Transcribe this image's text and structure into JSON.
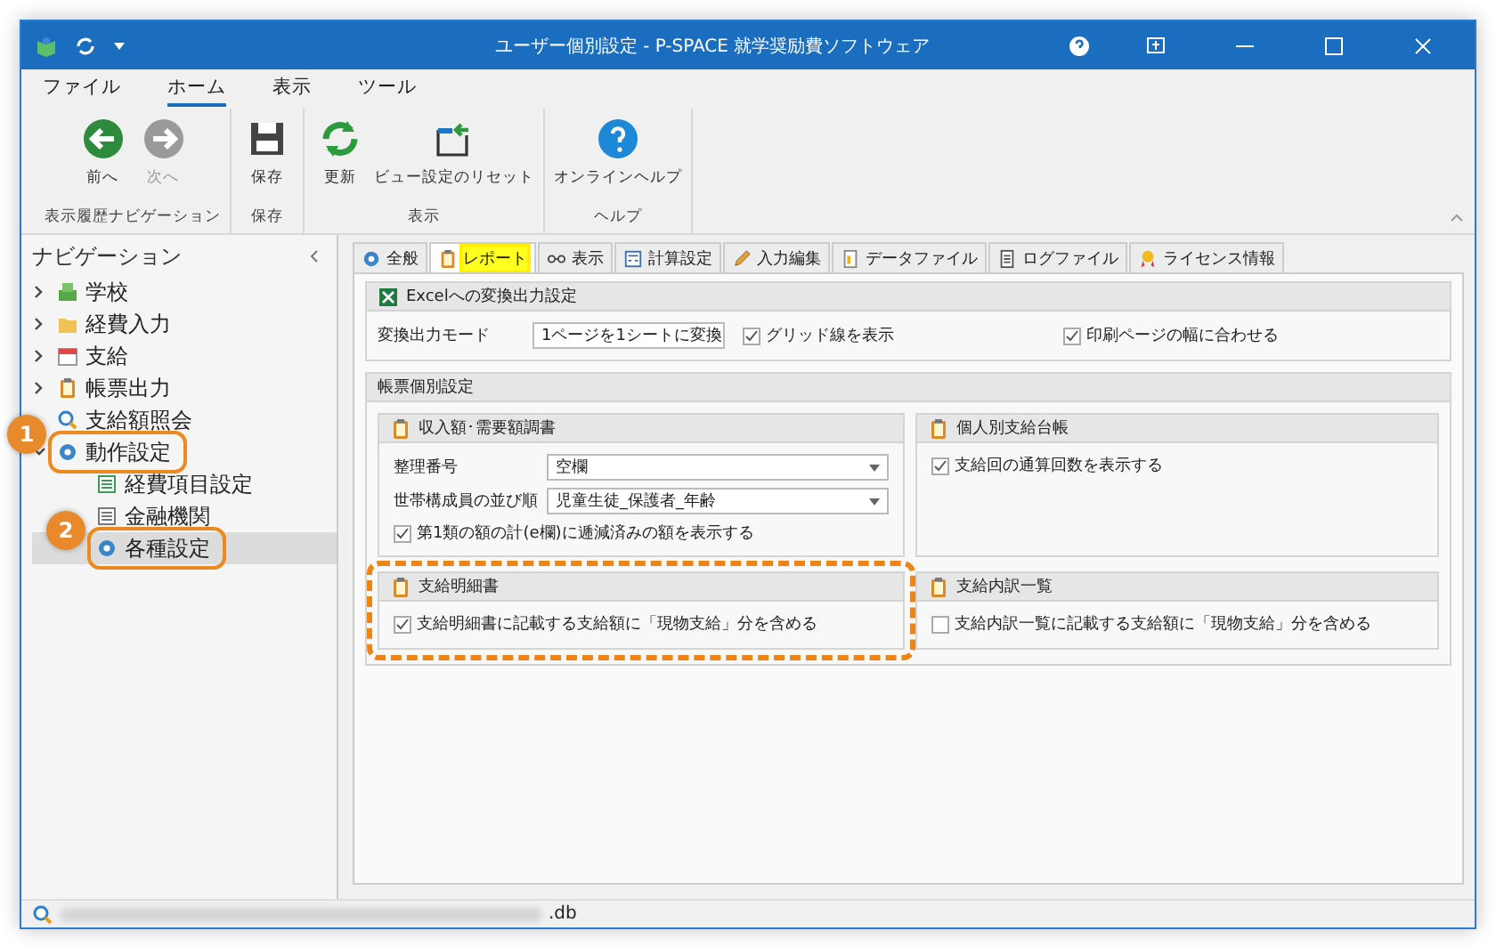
{
  "window": {
    "title": "ユーザー個別設定 - P-SPACE 就学奨励費ソフトウェア"
  },
  "menu_tabs": [
    {
      "label": "ファイル",
      "selected": false
    },
    {
      "label": "ホーム",
      "selected": true
    },
    {
      "label": "表示",
      "selected": false
    },
    {
      "label": "ツール",
      "selected": false
    }
  ],
  "ribbon": [
    {
      "label": "表示履歴ナビゲーション",
      "buttons": [
        {
          "label": "前へ",
          "disabled": false
        },
        {
          "label": "次へ",
          "disabled": true
        }
      ]
    },
    {
      "label": "保存",
      "buttons": [
        {
          "label": "保存",
          "disabled": false
        }
      ]
    },
    {
      "label": "表示",
      "buttons": [
        {
          "label": "更新",
          "disabled": false
        },
        {
          "label": "ビュー設定のリセット",
          "disabled": false
        }
      ]
    },
    {
      "label": "ヘルプ",
      "buttons": [
        {
          "label": "オンラインヘルプ",
          "disabled": false
        }
      ]
    }
  ],
  "navigation": {
    "title": "ナビゲーション",
    "items": [
      {
        "label": "学校",
        "expanded": false,
        "selected": false
      },
      {
        "label": "経費入力",
        "expanded": false,
        "selected": false
      },
      {
        "label": "支給",
        "expanded": false,
        "selected": false
      },
      {
        "label": "帳票出力",
        "expanded": false,
        "selected": false
      },
      {
        "label": "支給額照会",
        "selected": false
      },
      {
        "label": "動作設定",
        "expanded": true,
        "selected": false,
        "callout": "1",
        "children": [
          {
            "label": "経費項目設定",
            "selected": false
          },
          {
            "label": "金融機関",
            "selected": false
          },
          {
            "label": "各種設定",
            "selected": true,
            "callout": "2"
          }
        ]
      }
    ]
  },
  "tabs": [
    {
      "label": "全般",
      "selected": false
    },
    {
      "label": "レポート",
      "selected": true
    },
    {
      "label": "表示",
      "selected": false
    },
    {
      "label": "計算設定",
      "selected": false
    },
    {
      "label": "入力編集",
      "selected": false
    },
    {
      "label": "データファイル",
      "selected": false
    },
    {
      "label": "ログファイル",
      "selected": false
    },
    {
      "label": "ライセンス情報",
      "selected": false
    }
  ],
  "excel_section": {
    "title": "Excelへの変換出力設定",
    "mode_label": "変換出力モード",
    "mode_value": "1ページを1シートに変換",
    "checks": [
      {
        "label": "グリッド線を表示",
        "checked": true
      },
      {
        "label": "印刷ページの幅に合わせる",
        "checked": true
      }
    ]
  },
  "report_section": {
    "title": "帳票個別設定",
    "panels": [
      {
        "title": "収入額･需要額調書",
        "highlighted": false,
        "fields": [
          {
            "label": "整理番号",
            "value": "空欄"
          },
          {
            "label": "世帯構成員の並び順",
            "value": "児童生徒_保護者_年齢"
          }
        ],
        "checks": [
          {
            "label": "第1類の額の計(e欄)に逓減済みの額を表示する",
            "checked": true
          }
        ]
      },
      {
        "title": "個人別支給台帳",
        "highlighted": false,
        "checks": [
          {
            "label": "支給回の通算回数を表示する",
            "checked": true
          }
        ]
      },
      {
        "title": "支給明細書",
        "highlighted": true,
        "checks": [
          {
            "label": "支給明細書に記載する支給額に「現物支給」分を含める",
            "checked": true
          }
        ]
      },
      {
        "title": "支給内訳一覧",
        "highlighted": false,
        "checks": [
          {
            "label": "支給内訳一覧に記載する支給額に「現物支給」分を含める",
            "checked": false
          }
        ]
      }
    ]
  },
  "status_bar": {
    "path": ".db"
  }
}
